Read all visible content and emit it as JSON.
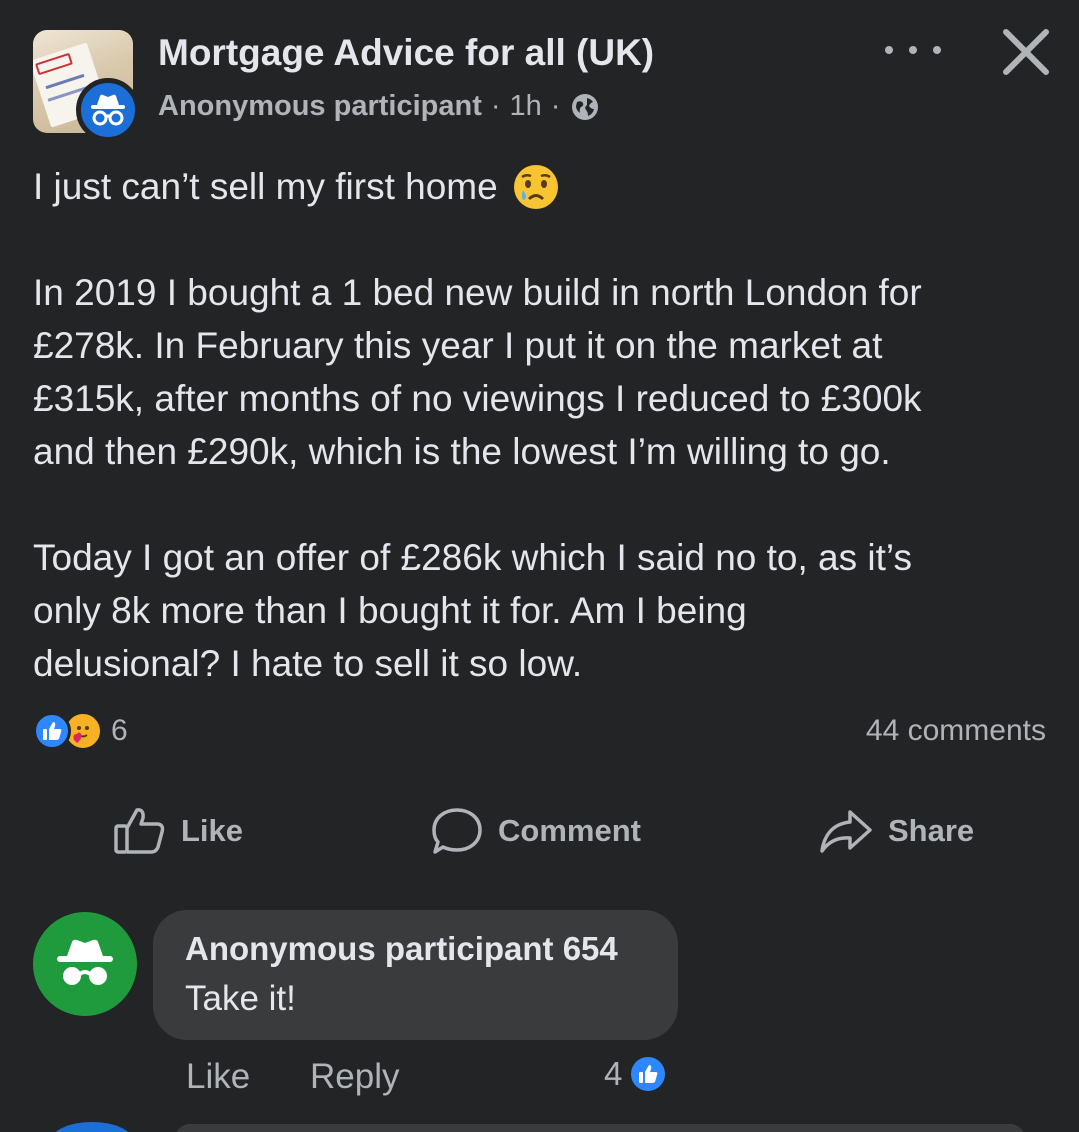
{
  "post": {
    "group_name": "Mortgage Advice for all (UK)",
    "author": "Anonymous participant",
    "separator": "·",
    "time": "1h",
    "privacy_icon": "globe-icon",
    "title_text": "I just can’t sell my first home",
    "title_emoji": "crying-face-emoji",
    "paragraph_2_lines": [
      "In 2019 I bought a 1 bed new build in north London for",
      "£278k. In February this year I put it on the market at",
      "£315k, after months of no viewings I reduced to £300k",
      "and then £290k, which is the lowest I’m willing to go."
    ],
    "paragraph_3_lines": [
      "Today I got an offer of £286k which I said no to, as it’s",
      "only 8k more than I bought it for. Am I being",
      "delusional? I hate to sell it so low."
    ]
  },
  "reactions": {
    "icons": [
      "like-reaction-icon",
      "care-reaction-icon"
    ],
    "count": "6",
    "comments_label": "44 comments"
  },
  "actions": {
    "like_label": "Like",
    "comment_label": "Comment",
    "share_label": "Share"
  },
  "comment": {
    "author": "Anonymous participant 654",
    "text": "Take it!",
    "like_label": "Like",
    "reply_label": "Reply",
    "like_count": "4"
  },
  "colors": {
    "background": "#232425",
    "text_primary": "#e4e6eb",
    "text_secondary": "#b0b3b8",
    "bubble": "#3a3b3c",
    "like_blue": "#2d88ff",
    "anon_avatar_blue": "#1c6fd6",
    "anon_avatar_green": "#1f9a3c"
  }
}
